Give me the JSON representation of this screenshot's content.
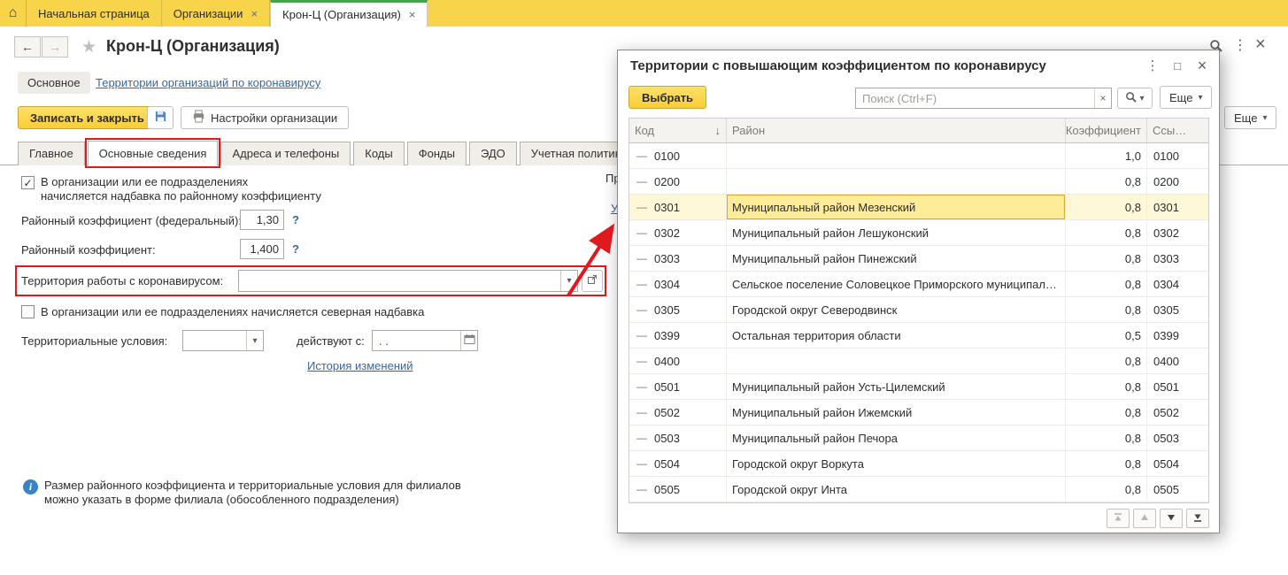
{
  "top_bar": {
    "tabs": [
      {
        "label": "Начальная страница",
        "closable": false,
        "active": false
      },
      {
        "label": "Организации",
        "closable": true,
        "active": false
      },
      {
        "label": "Крон-Ц (Организация)",
        "closable": true,
        "active": true
      }
    ]
  },
  "header": {
    "title": "Крон-Ц (Организация)"
  },
  "nav": {
    "current": "Основное",
    "link": "Территории организаций по коронавирусу"
  },
  "toolbar": {
    "save_close": "Записать и закрыть",
    "org_settings": "Настройки организации",
    "more": "Еще"
  },
  "form_tabs": [
    "Главное",
    "Основные сведения",
    "Адреса и телефоны",
    "Коды",
    "Фонды",
    "ЭДО",
    "Учетная политика и другие настройки"
  ],
  "form": {
    "district_allowance_line1": "В организации или ее подразделениях",
    "district_allowance_line2": "начисляется надбавка по районному коэффициенту",
    "federal_coef_label": "Районный коэффициент (федеральный):",
    "federal_coef_value": "1,30",
    "coef_label": "Районный коэффициент:",
    "coef_value": "1,400",
    "help_mark": "?",
    "covid_territory_label": "Территория работы с коронавирусом:",
    "north_allowance_label": "В организации или ее подразделениях начисляется северная надбавка",
    "territorial_conditions_label": "Территориальные условия:",
    "valid_from_label": "действуют с:",
    "date_placeholder": ". .",
    "history_link": "История изменений",
    "info_line1": "Размер районного коэффициента и территориальные условия для филиалов",
    "info_line2": "можно указать в форме филиала (обособленного подразделения)"
  },
  "fragments": {
    "f1": "Пр",
    "f2": "У"
  },
  "popup": {
    "title": "Территории с повышающим коэффициентом по коронавирусу",
    "select_button": "Выбрать",
    "search_placeholder": "Поиск (Ctrl+F)",
    "more_button": "Еще",
    "columns": {
      "code": "Код",
      "district": "Район",
      "coef": "Коэффициент",
      "ref": "Ссы…"
    },
    "selected_index": 2,
    "rows": [
      {
        "code": "0100",
        "district": "",
        "coef": "1,0",
        "ref": "0100"
      },
      {
        "code": "0200",
        "district": "",
        "coef": "0,8",
        "ref": "0200"
      },
      {
        "code": "0301",
        "district": "Муниципальный район Мезенский",
        "coef": "0,8",
        "ref": "0301"
      },
      {
        "code": "0302",
        "district": "Муниципальный район Лешуконский",
        "coef": "0,8",
        "ref": "0302"
      },
      {
        "code": "0303",
        "district": "Муниципальный район Пинежский",
        "coef": "0,8",
        "ref": "0303"
      },
      {
        "code": "0304",
        "district": "Сельское поселение Соловецкое Приморского муниципал…",
        "coef": "0,8",
        "ref": "0304"
      },
      {
        "code": "0305",
        "district": "Городской округ Северодвинск",
        "coef": "0,8",
        "ref": "0305"
      },
      {
        "code": "0399",
        "district": "Остальная территория области",
        "coef": "0,5",
        "ref": "0399"
      },
      {
        "code": "0400",
        "district": "",
        "coef": "0,8",
        "ref": "0400"
      },
      {
        "code": "0501",
        "district": "Муниципальный район Усть-Цилемский",
        "coef": "0,8",
        "ref": "0501"
      },
      {
        "code": "0502",
        "district": "Муниципальный район Ижемский",
        "coef": "0,8",
        "ref": "0502"
      },
      {
        "code": "0503",
        "district": "Муниципальный район Печора",
        "coef": "0,8",
        "ref": "0503"
      },
      {
        "code": "0504",
        "district": "Городской округ Воркута",
        "coef": "0,8",
        "ref": "0504"
      },
      {
        "code": "0505",
        "district": "Городской округ Инта",
        "coef": "0,8",
        "ref": "0505"
      }
    ]
  }
}
